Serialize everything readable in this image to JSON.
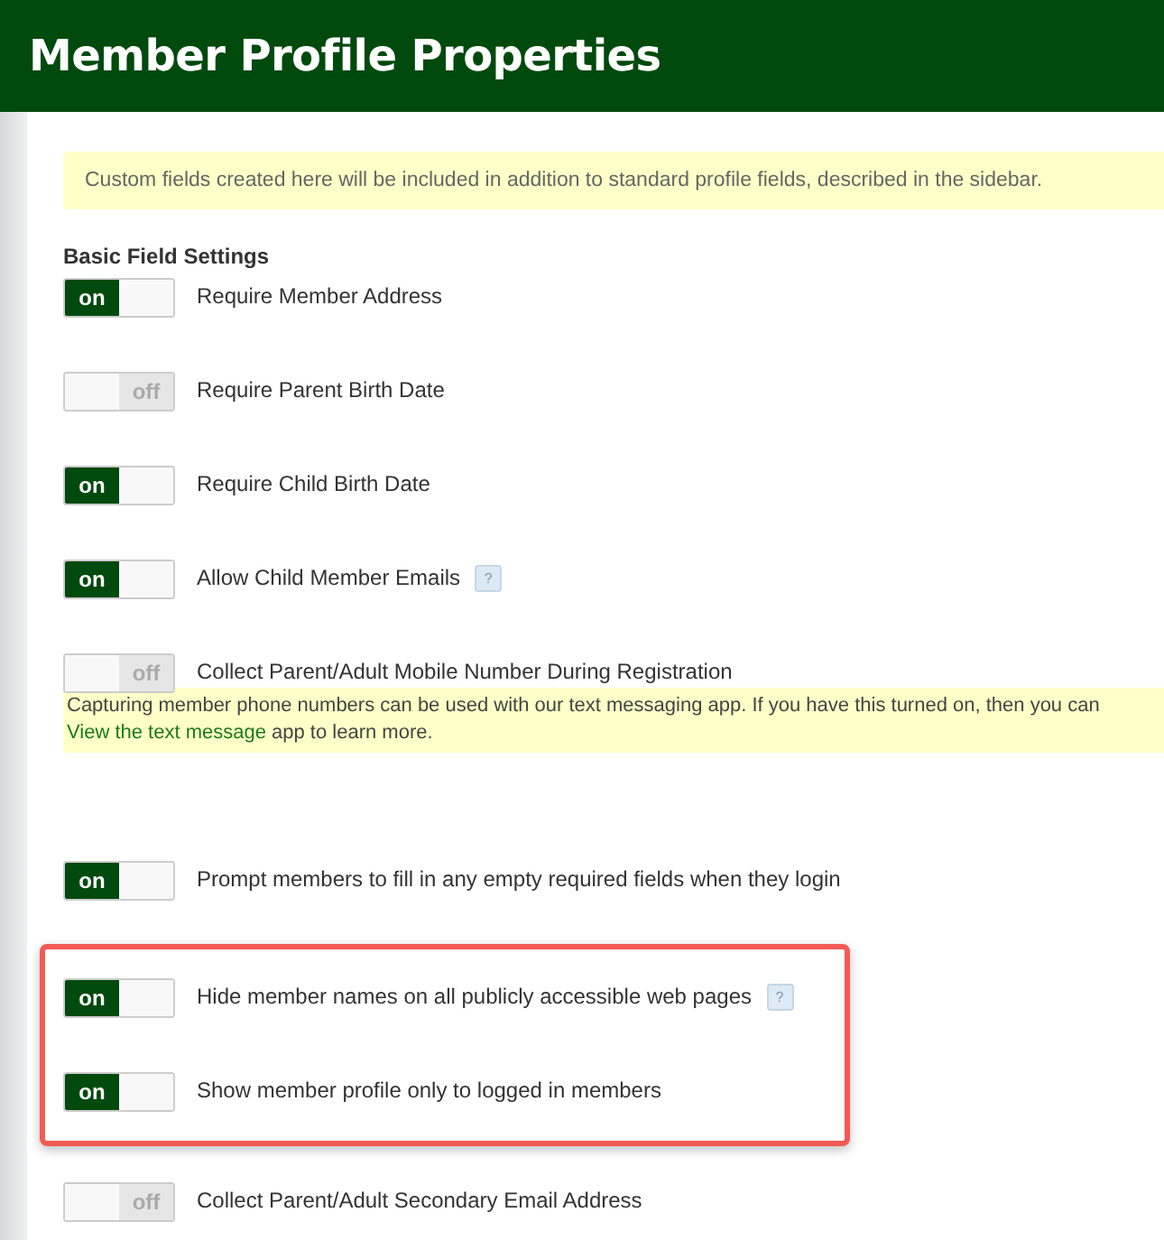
{
  "header": {
    "title": "Member Profile Properties"
  },
  "intro_notice": "Custom fields created here will be included in addition to standard profile fields, described in the sidebar.",
  "section_title": "Basic Field Settings",
  "items": [
    {
      "kind": "toggle",
      "label": "Require Member Address",
      "on": true,
      "switch_text": "on",
      "highlighted": false
    },
    {
      "kind": "toggle",
      "label": "Require Parent Birth Date",
      "on": false,
      "switch_text": "off",
      "highlighted": false
    },
    {
      "kind": "toggle",
      "label": "Require Child Birth Date",
      "on": true,
      "switch_text": "on",
      "highlighted": false
    },
    {
      "kind": "toggle",
      "label": "Allow Child Member Emails",
      "on": true,
      "switch_text": "on",
      "help": "?",
      "highlighted": false
    },
    {
      "kind": "toggle",
      "label": "Collect Parent/Adult Mobile Number During Registration",
      "on": false,
      "switch_text": "off",
      "highlighted": false
    },
    {
      "kind": "notice",
      "text": "Capturing member phone numbers can be used with our text messaging app. If you have this turned on, then you can",
      "link": "View the text message",
      "after": " app to learn more."
    },
    {
      "kind": "toggle",
      "label": "Prompt members to fill in any empty required fields when they login",
      "on": true,
      "switch_text": "on",
      "highlighted": false
    },
    {
      "kind": "toggle",
      "label": "Hide member names on all publicly accessible web pages",
      "on": true,
      "switch_text": "on",
      "help": "?",
      "highlighted": true
    },
    {
      "kind": "toggle",
      "label": "Show member profile only to logged in members",
      "on": true,
      "switch_text": "on",
      "highlighted": true
    },
    {
      "kind": "toggle",
      "label": "Collect Parent/Adult Secondary Email Address",
      "on": false,
      "switch_text": "off",
      "highlighted": false
    }
  ]
}
